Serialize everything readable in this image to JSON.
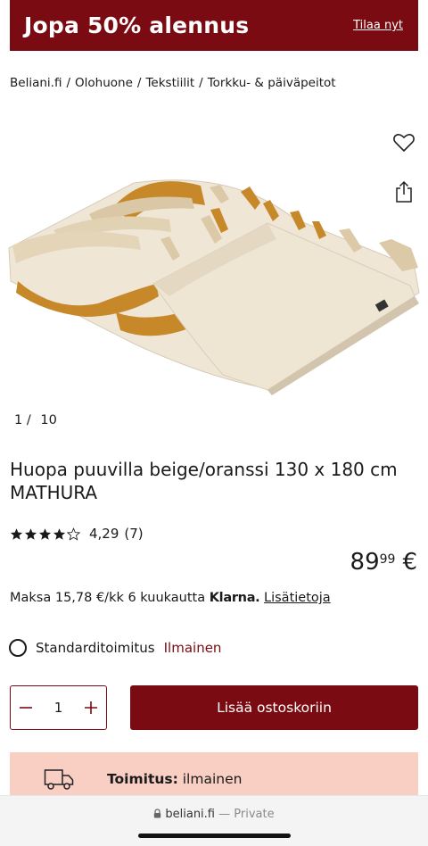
{
  "promo": {
    "title": "Jopa 50% alennus",
    "link": "Tilaa nyt"
  },
  "breadcrumb": [
    "Beliani.fi",
    "Olohuone",
    "Tekstiilit",
    "Torkku- & päiväpeitot"
  ],
  "gallery": {
    "current": "1",
    "total": "10"
  },
  "product": {
    "title": "Huopa puuvilla beige/oranssi 130 x 180 cm MATHURA",
    "rating": "4,29",
    "reviews": "(7)",
    "stars": 4.29,
    "price_main": "89",
    "price_cents": "99",
    "currency": "€"
  },
  "klarna": {
    "text": "Maksa 15,78 €/kk 6 kuukautta",
    "brand": "Klarna.",
    "link": "Lisätietoja"
  },
  "delivery": {
    "label": "Standarditoimitus",
    "price": "Ilmainen"
  },
  "cart": {
    "quantity": "1",
    "button": "Lisää ostoskoriin"
  },
  "shipping_banner": {
    "label": "Toimitus:",
    "value": "ilmainen"
  },
  "browser": {
    "domain": "beliani.fi",
    "mode": "— Private"
  },
  "colors": {
    "brand": "#7a0b12",
    "banner": "#f9cfc4"
  }
}
